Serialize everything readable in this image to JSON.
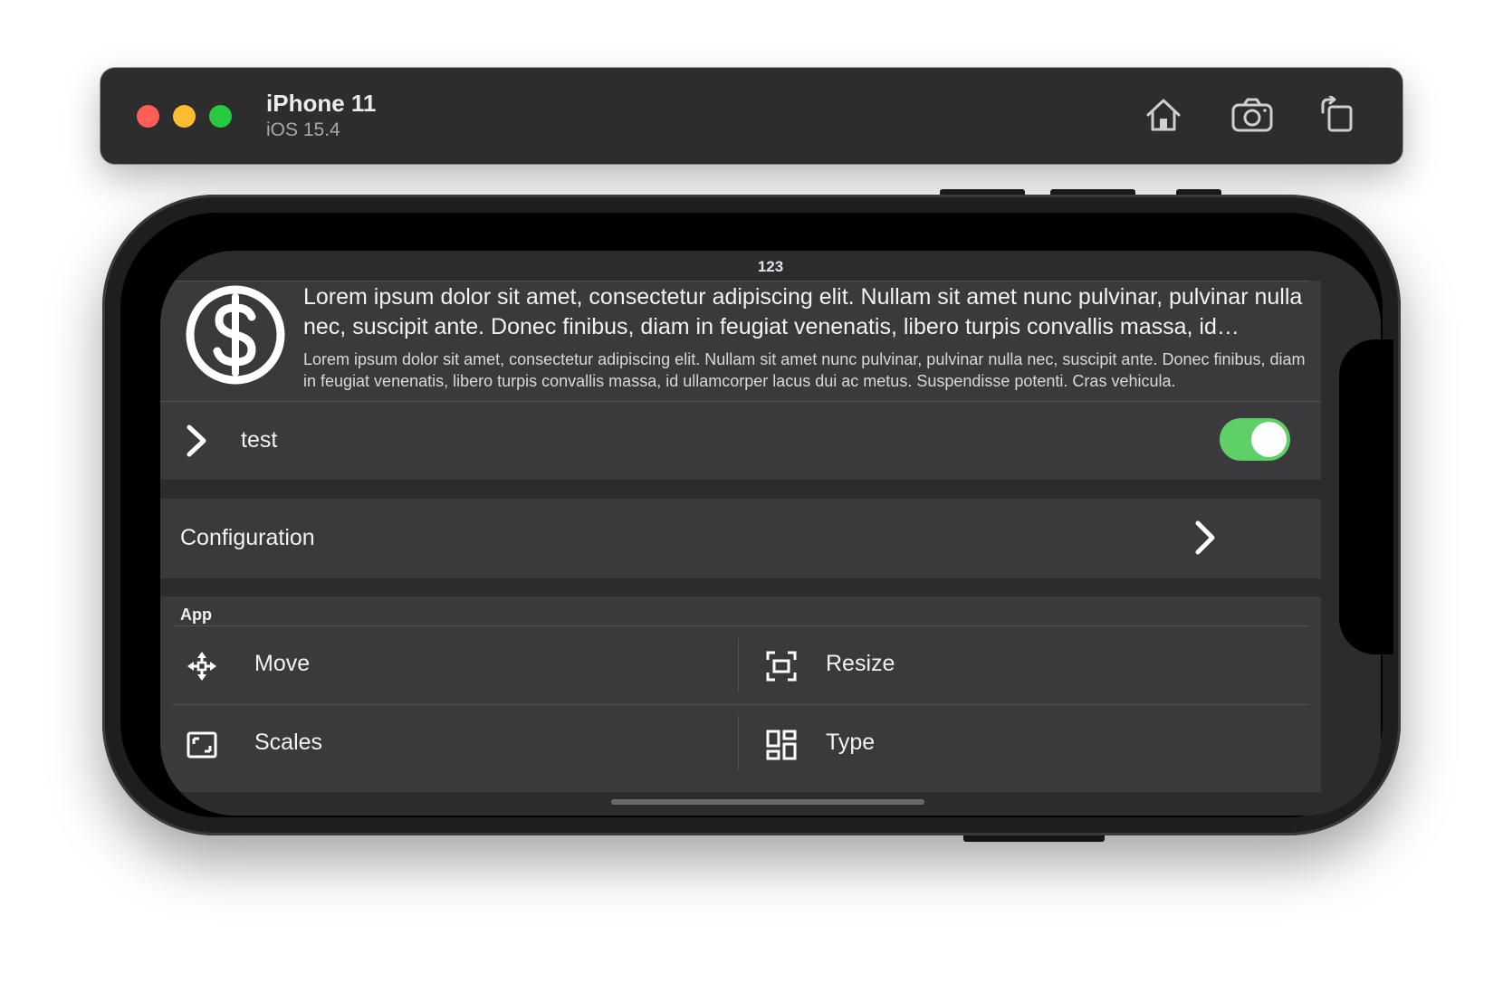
{
  "window": {
    "device_name": "iPhone 11",
    "os_version": "iOS 15.4",
    "toolbar": {
      "home_icon": "home-icon",
      "screenshot_icon": "camera-icon",
      "rotate_icon": "rotate-icon"
    },
    "traffic_lights": {
      "close": "#ff5f57",
      "minimize": "#febc2e",
      "zoom": "#28c840"
    }
  },
  "app": {
    "status_number": "123",
    "card": {
      "icon": "dollar-circle-icon",
      "title": "Lorem ipsum dolor sit amet, consectetur adipiscing elit. Nullam sit amet nunc pulvinar, pulvinar nulla nec, suscipit ante. Donec finibus, diam in feugiat venenatis, libero turpis convallis massa, id ullamcorper lacus dui ac metus. Suspendisse potenti.",
      "subtitle": "Lorem ipsum dolor sit amet, consectetur adipiscing elit. Nullam sit amet nunc pulvinar, pulvinar nulla nec, suscipit ante. Donec finibus, diam in feugiat venenatis, libero turpis convallis massa, id ullamcorper lacus dui ac metus. Suspendisse potenti. Cras vehicula."
    },
    "test_row": {
      "label": "test",
      "toggle_on": true,
      "toggle_color": "#5fd068"
    },
    "configuration_row": {
      "label": "Configuration"
    },
    "section": {
      "header": "App",
      "items": [
        {
          "label": "Move",
          "icon": "move-arrows-icon"
        },
        {
          "label": "Resize",
          "icon": "resize-frame-icon"
        },
        {
          "label": "Scales",
          "icon": "scale-frame-icon"
        },
        {
          "label": "Type",
          "icon": "grid-layout-icon"
        }
      ]
    }
  }
}
